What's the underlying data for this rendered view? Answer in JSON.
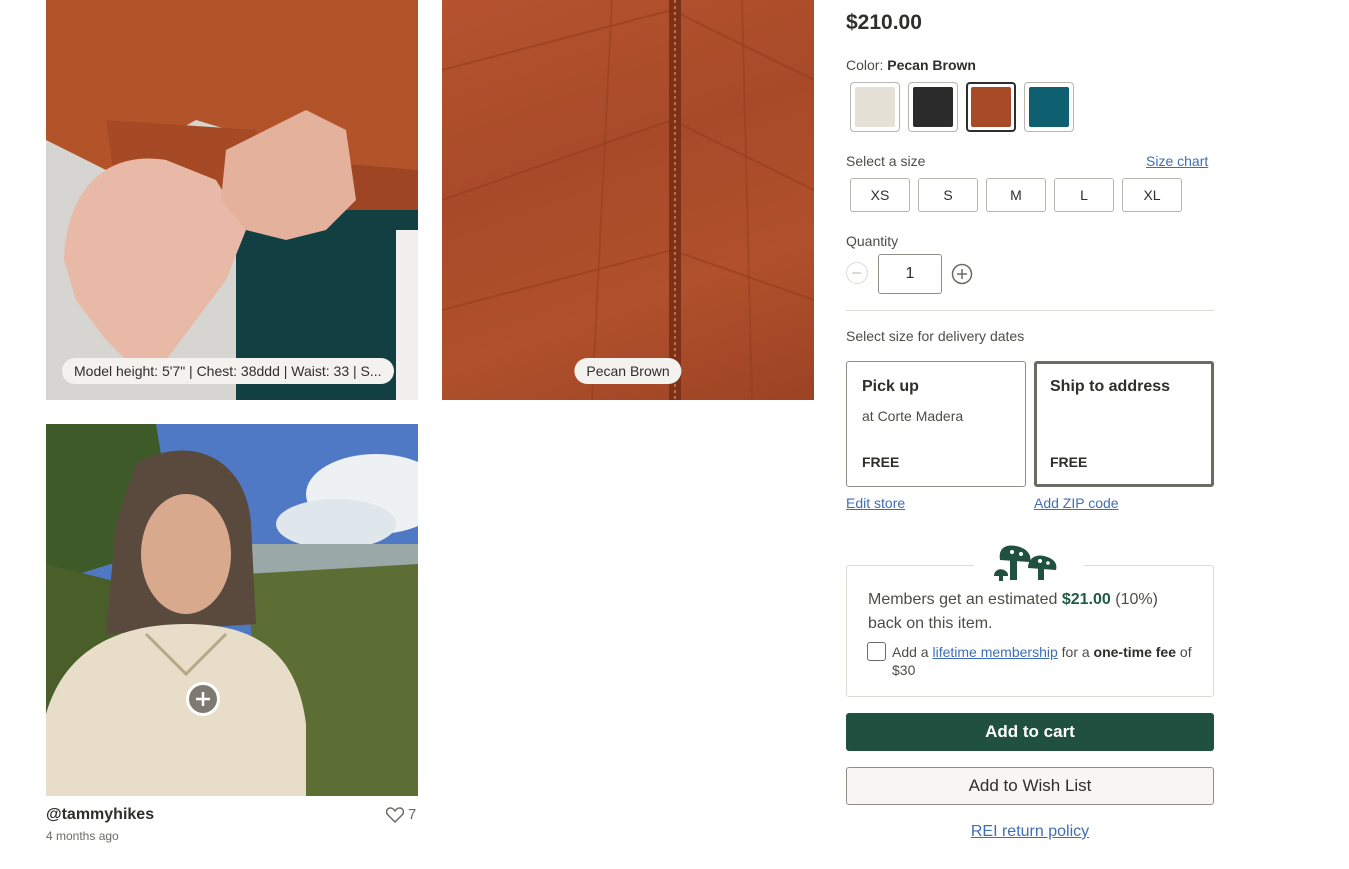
{
  "gallery": {
    "model_pill": "Model height: 5'7\" | Chest: 38ddd | Waist: 33 | S...",
    "color_pill": "Pecan Brown",
    "ugc": {
      "user": "@tammyhikes",
      "time": "4 months ago",
      "likes": "7"
    }
  },
  "product": {
    "price": "$210.00",
    "color_label": "Color:",
    "color_value": "Pecan Brown",
    "swatches": [
      {
        "name": "cream",
        "color": "#e6e1d6"
      },
      {
        "name": "black",
        "color": "#2b2b2b"
      },
      {
        "name": "pecan-brown",
        "color": "#a84a28",
        "selected": true
      },
      {
        "name": "teal",
        "color": "#0e5f70"
      }
    ],
    "size_label": "Select a size",
    "size_chart": "Size chart",
    "sizes": [
      "XS",
      "S",
      "M",
      "L",
      "XL"
    ],
    "quantity_label": "Quantity",
    "quantity": "1",
    "delivery_label": "Select size for delivery dates",
    "pickup": {
      "title": "Pick up",
      "sub": "at Corte Madera",
      "price": "FREE",
      "link": "Edit store"
    },
    "ship": {
      "title": "Ship to address",
      "sub": "",
      "price": "FREE",
      "link": "Add ZIP code"
    }
  },
  "membership": {
    "text_pre": "Members get an estimated ",
    "amount": "$21.00",
    "text_post": " (10%) back on this item.",
    "opt_pre": "Add a ",
    "opt_link": "lifetime membership",
    "opt_mid": " for a ",
    "opt_bold": "one-time fee",
    "opt_post": " of $30"
  },
  "actions": {
    "add_to_cart": "Add to cart",
    "add_to_wishlist": "Add to Wish List",
    "return_policy": "REI return policy"
  },
  "colors": {
    "primary": "#1f5040",
    "link": "#406eb5"
  }
}
